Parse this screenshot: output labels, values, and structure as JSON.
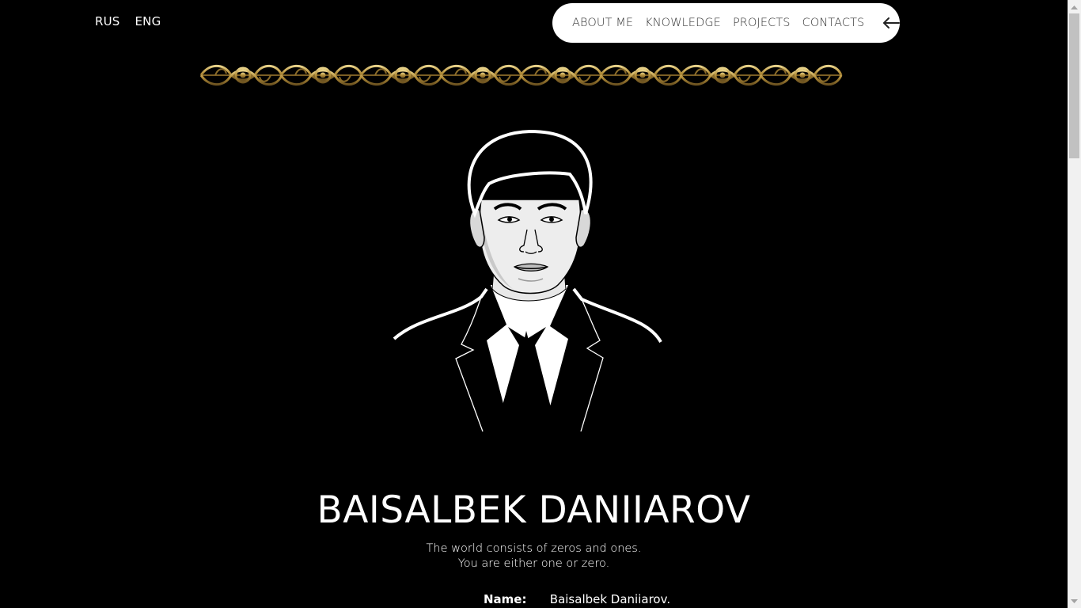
{
  "lang": {
    "rus": "RUS",
    "eng": "ENG"
  },
  "nav": {
    "about": "ABOUT ME",
    "knowledge": "KNOWLEDGE",
    "projects": "PROJECTS",
    "contacts": "CONTACTS",
    "back_icon": "arrow-left-icon"
  },
  "hero": {
    "name": "BAISALBEK DANIIAROV",
    "tagline_line1": "The world consists of zeros and ones.",
    "tagline_line2": "You are either one or zero."
  },
  "info": {
    "name_label": "Name:",
    "name_value": "Baisalbek Daniiarov."
  },
  "colors": {
    "background": "#000000",
    "nav_pill": "#ffffff",
    "ornament_gold": "#c9a94e"
  },
  "scroll": {
    "position_fraction": 0
  }
}
